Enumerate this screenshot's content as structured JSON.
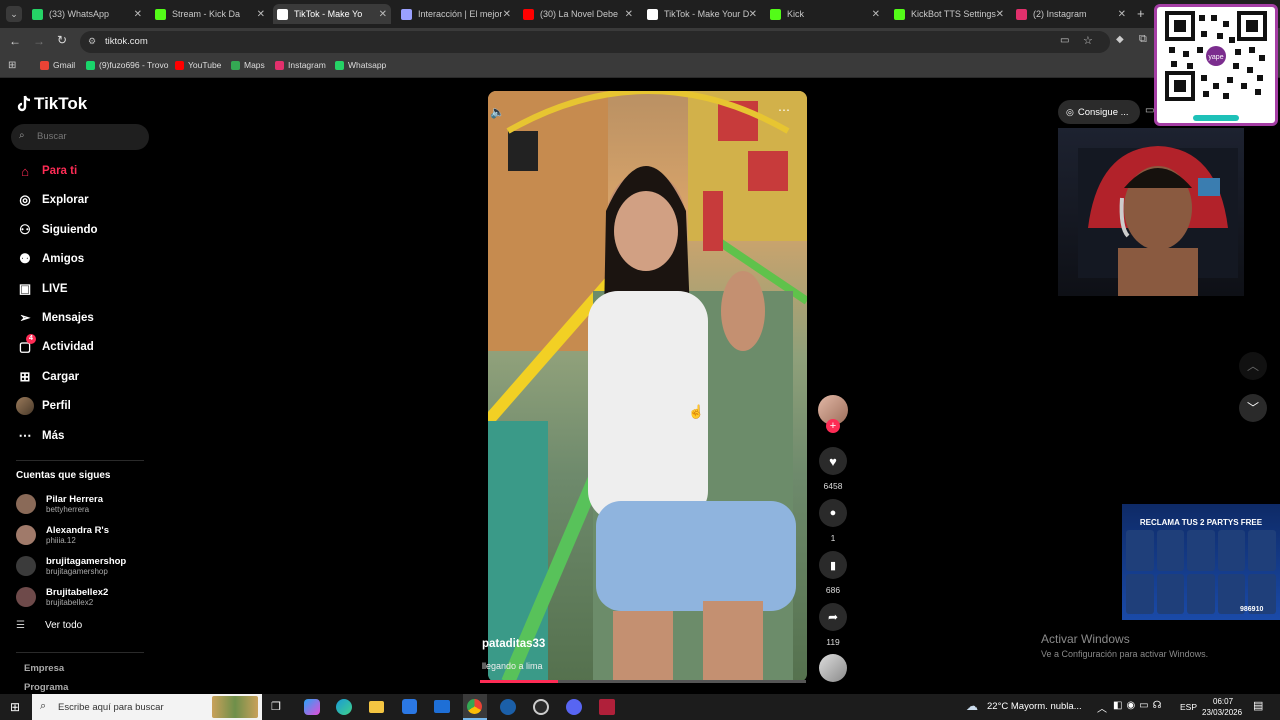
{
  "browser": {
    "tabs": [
      {
        "label": "(33) WhatsApp",
        "color": "#25d366"
      },
      {
        "label": "Stream - Kick Da",
        "color": "#53fc18"
      },
      {
        "label": "TikTok - Make Yo",
        "color": "#ffffff"
      },
      {
        "label": "Interacción | El mejor",
        "color": "#9aa0ff"
      },
      {
        "label": "(30) La Novel Debe",
        "color": "#ff0000"
      },
      {
        "label": "TikTok - Make Your D",
        "color": "#ffffff"
      },
      {
        "label": "Kick",
        "color": "#53fc18"
      },
      {
        "label": "KickBot TTS Settings",
        "color": "#53fc18"
      },
      {
        "label": "(2) Instagram",
        "color": "#e1306c"
      }
    ],
    "url": "tiktok.com",
    "bookmarks": [
      {
        "label": "Gmail",
        "color": "#ea4335"
      },
      {
        "label": "(9)fuzo696 - Trovo",
        "color": "#19d66b"
      },
      {
        "label": "YouTube",
        "color": "#ff0000"
      },
      {
        "label": "Maps",
        "color": "#34a853"
      },
      {
        "label": "Instagram",
        "color": "#e1306c"
      },
      {
        "label": "Whatsapp",
        "color": "#25d366"
      }
    ]
  },
  "tiktok": {
    "logo": "TikTok",
    "search_placeholder": "Buscar",
    "nav": [
      {
        "label": "Para ti",
        "icon": "home-icon",
        "active": true
      },
      {
        "label": "Explorar",
        "icon": "compass-icon"
      },
      {
        "label": "Siguiendo",
        "icon": "user-icon"
      },
      {
        "label": "Amigos",
        "icon": "friends-icon"
      },
      {
        "label": "LIVE",
        "icon": "live-icon"
      },
      {
        "label": "Mensajes",
        "icon": "send-icon"
      },
      {
        "label": "Actividad",
        "icon": "activity-icon",
        "badge": "4"
      },
      {
        "label": "Cargar",
        "icon": "plus-icon"
      },
      {
        "label": "Perfil",
        "icon": "avatar-icon"
      },
      {
        "label": "Más",
        "icon": "more-icon"
      }
    ],
    "following_title": "Cuentas que sigues",
    "following": [
      {
        "name": "Pilar Herrera",
        "handle": "bettyherrera"
      },
      {
        "name": "Alexandra R's",
        "handle": "phiiia.12"
      },
      {
        "name": "brujitagamershop",
        "handle": "brujitagamershop"
      },
      {
        "name": "Brujitabellex2",
        "handle": "brujitabellex2"
      }
    ],
    "see_all": "Ver todo",
    "footer": [
      "Empresa",
      "Programa"
    ],
    "accent": "#fe2c55"
  },
  "video": {
    "username": "pataditas33",
    "caption": "llegando a lima",
    "likes": "6458",
    "comments": "1",
    "saves": "686",
    "shares": "119"
  },
  "overlay": {
    "get_coins": "Consigue ...",
    "activate_title": "Activar Windows",
    "activate_sub": "Ve a Configuración para activar Windows.",
    "promo_title": "RECLAMA TUS 2 PARTYS FREE",
    "promo_code": "986910"
  },
  "taskbar": {
    "search_placeholder": "Escribe aquí para buscar",
    "weather": "22°C  Mayorm. nubla...",
    "lang": "ESP",
    "time": "06:07",
    "date": "23/03/2026"
  }
}
